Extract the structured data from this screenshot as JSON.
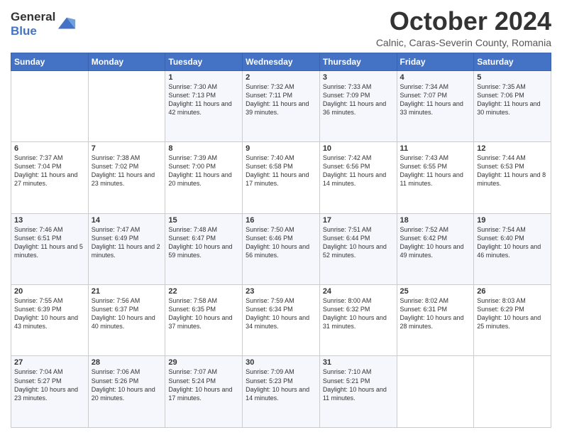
{
  "header": {
    "logo_line1": "General",
    "logo_line2": "Blue",
    "month": "October 2024",
    "location": "Calnic, Caras-Severin County, Romania"
  },
  "days_of_week": [
    "Sunday",
    "Monday",
    "Tuesday",
    "Wednesday",
    "Thursday",
    "Friday",
    "Saturday"
  ],
  "weeks": [
    [
      {
        "day": "",
        "text": ""
      },
      {
        "day": "",
        "text": ""
      },
      {
        "day": "1",
        "text": "Sunrise: 7:30 AM\nSunset: 7:13 PM\nDaylight: 11 hours and 42 minutes."
      },
      {
        "day": "2",
        "text": "Sunrise: 7:32 AM\nSunset: 7:11 PM\nDaylight: 11 hours and 39 minutes."
      },
      {
        "day": "3",
        "text": "Sunrise: 7:33 AM\nSunset: 7:09 PM\nDaylight: 11 hours and 36 minutes."
      },
      {
        "day": "4",
        "text": "Sunrise: 7:34 AM\nSunset: 7:07 PM\nDaylight: 11 hours and 33 minutes."
      },
      {
        "day": "5",
        "text": "Sunrise: 7:35 AM\nSunset: 7:06 PM\nDaylight: 11 hours and 30 minutes."
      }
    ],
    [
      {
        "day": "6",
        "text": "Sunrise: 7:37 AM\nSunset: 7:04 PM\nDaylight: 11 hours and 27 minutes."
      },
      {
        "day": "7",
        "text": "Sunrise: 7:38 AM\nSunset: 7:02 PM\nDaylight: 11 hours and 23 minutes."
      },
      {
        "day": "8",
        "text": "Sunrise: 7:39 AM\nSunset: 7:00 PM\nDaylight: 11 hours and 20 minutes."
      },
      {
        "day": "9",
        "text": "Sunrise: 7:40 AM\nSunset: 6:58 PM\nDaylight: 11 hours and 17 minutes."
      },
      {
        "day": "10",
        "text": "Sunrise: 7:42 AM\nSunset: 6:56 PM\nDaylight: 11 hours and 14 minutes."
      },
      {
        "day": "11",
        "text": "Sunrise: 7:43 AM\nSunset: 6:55 PM\nDaylight: 11 hours and 11 minutes."
      },
      {
        "day": "12",
        "text": "Sunrise: 7:44 AM\nSunset: 6:53 PM\nDaylight: 11 hours and 8 minutes."
      }
    ],
    [
      {
        "day": "13",
        "text": "Sunrise: 7:46 AM\nSunset: 6:51 PM\nDaylight: 11 hours and 5 minutes."
      },
      {
        "day": "14",
        "text": "Sunrise: 7:47 AM\nSunset: 6:49 PM\nDaylight: 11 hours and 2 minutes."
      },
      {
        "day": "15",
        "text": "Sunrise: 7:48 AM\nSunset: 6:47 PM\nDaylight: 10 hours and 59 minutes."
      },
      {
        "day": "16",
        "text": "Sunrise: 7:50 AM\nSunset: 6:46 PM\nDaylight: 10 hours and 56 minutes."
      },
      {
        "day": "17",
        "text": "Sunrise: 7:51 AM\nSunset: 6:44 PM\nDaylight: 10 hours and 52 minutes."
      },
      {
        "day": "18",
        "text": "Sunrise: 7:52 AM\nSunset: 6:42 PM\nDaylight: 10 hours and 49 minutes."
      },
      {
        "day": "19",
        "text": "Sunrise: 7:54 AM\nSunset: 6:40 PM\nDaylight: 10 hours and 46 minutes."
      }
    ],
    [
      {
        "day": "20",
        "text": "Sunrise: 7:55 AM\nSunset: 6:39 PM\nDaylight: 10 hours and 43 minutes."
      },
      {
        "day": "21",
        "text": "Sunrise: 7:56 AM\nSunset: 6:37 PM\nDaylight: 10 hours and 40 minutes."
      },
      {
        "day": "22",
        "text": "Sunrise: 7:58 AM\nSunset: 6:35 PM\nDaylight: 10 hours and 37 minutes."
      },
      {
        "day": "23",
        "text": "Sunrise: 7:59 AM\nSunset: 6:34 PM\nDaylight: 10 hours and 34 minutes."
      },
      {
        "day": "24",
        "text": "Sunrise: 8:00 AM\nSunset: 6:32 PM\nDaylight: 10 hours and 31 minutes."
      },
      {
        "day": "25",
        "text": "Sunrise: 8:02 AM\nSunset: 6:31 PM\nDaylight: 10 hours and 28 minutes."
      },
      {
        "day": "26",
        "text": "Sunrise: 8:03 AM\nSunset: 6:29 PM\nDaylight: 10 hours and 25 minutes."
      }
    ],
    [
      {
        "day": "27",
        "text": "Sunrise: 7:04 AM\nSunset: 5:27 PM\nDaylight: 10 hours and 23 minutes."
      },
      {
        "day": "28",
        "text": "Sunrise: 7:06 AM\nSunset: 5:26 PM\nDaylight: 10 hours and 20 minutes."
      },
      {
        "day": "29",
        "text": "Sunrise: 7:07 AM\nSunset: 5:24 PM\nDaylight: 10 hours and 17 minutes."
      },
      {
        "day": "30",
        "text": "Sunrise: 7:09 AM\nSunset: 5:23 PM\nDaylight: 10 hours and 14 minutes."
      },
      {
        "day": "31",
        "text": "Sunrise: 7:10 AM\nSunset: 5:21 PM\nDaylight: 10 hours and 11 minutes."
      },
      {
        "day": "",
        "text": ""
      },
      {
        "day": "",
        "text": ""
      }
    ]
  ]
}
